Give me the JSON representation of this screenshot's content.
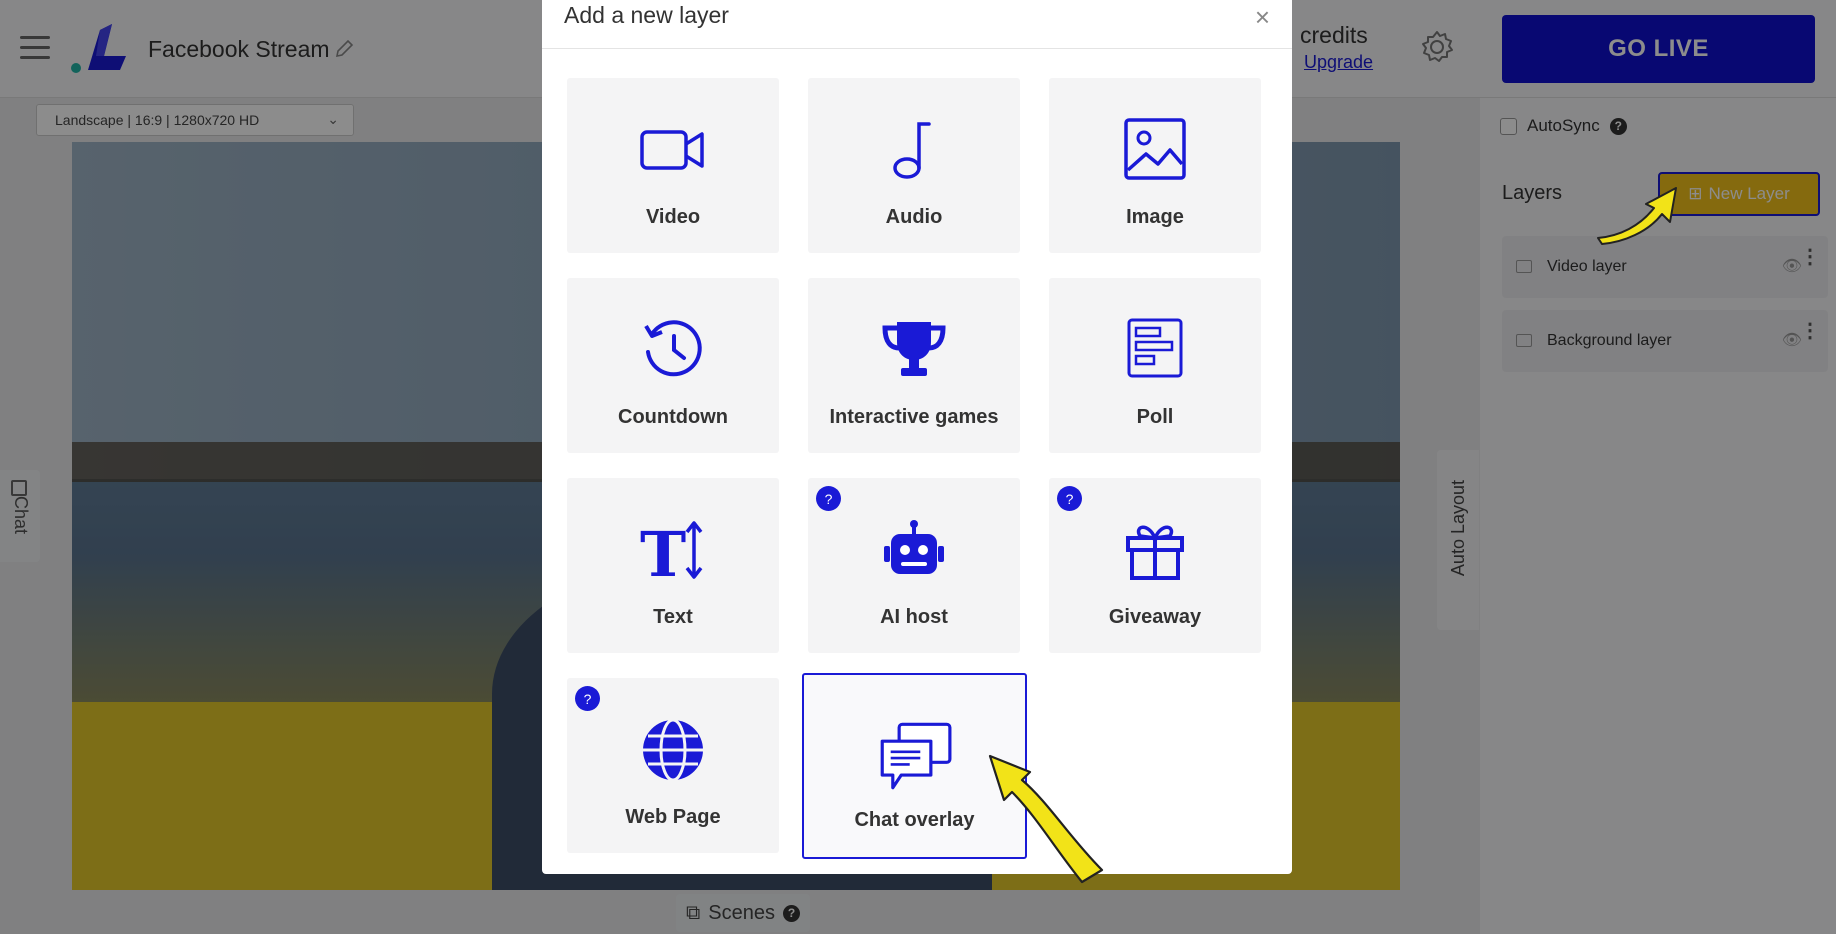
{
  "app": {
    "stream_title": "Facebook Stream",
    "credits_label": "credits",
    "upgrade_label": "Upgrade",
    "go_live_label": "GO LIVE",
    "resolution": "Landscape | 16:9 | 1280x720 HD",
    "chat_tab_label": "Chat",
    "auto_layout_label": "Auto Layout",
    "scenes_label": "Scenes"
  },
  "right_panel": {
    "autosync_label": "AutoSync",
    "layers_title": "Layers",
    "new_layer_label": "New Layer",
    "layers": [
      {
        "label": "Video layer"
      },
      {
        "label": "Background layer"
      }
    ]
  },
  "modal": {
    "title": "Add a new layer",
    "close_icon": "×",
    "tiles": [
      {
        "label": "Video",
        "icon": "video-camera-icon",
        "help": false
      },
      {
        "label": "Audio",
        "icon": "music-note-icon",
        "help": false
      },
      {
        "label": "Image",
        "icon": "image-icon",
        "help": false
      },
      {
        "label": "Countdown",
        "icon": "clock-history-icon",
        "help": false
      },
      {
        "label": "Interactive games",
        "icon": "trophy-icon",
        "help": false
      },
      {
        "label": "Poll",
        "icon": "poll-icon",
        "help": false
      },
      {
        "label": "Text",
        "icon": "text-size-icon",
        "help": false
      },
      {
        "label": "AI host",
        "icon": "robot-icon",
        "help": true
      },
      {
        "label": "Giveaway",
        "icon": "gift-icon",
        "help": true
      },
      {
        "label": "Web Page",
        "icon": "globe-icon",
        "help": true
      },
      {
        "label": "Chat overlay",
        "icon": "chat-bubbles-icon",
        "help": false,
        "selected": true
      }
    ]
  },
  "colors": {
    "brand_blue": "#1a1ad6",
    "go_live_bg": "#0f0fcf",
    "new_layer_bg": "#f2c21b",
    "tile_bg": "#f4f4f5"
  }
}
